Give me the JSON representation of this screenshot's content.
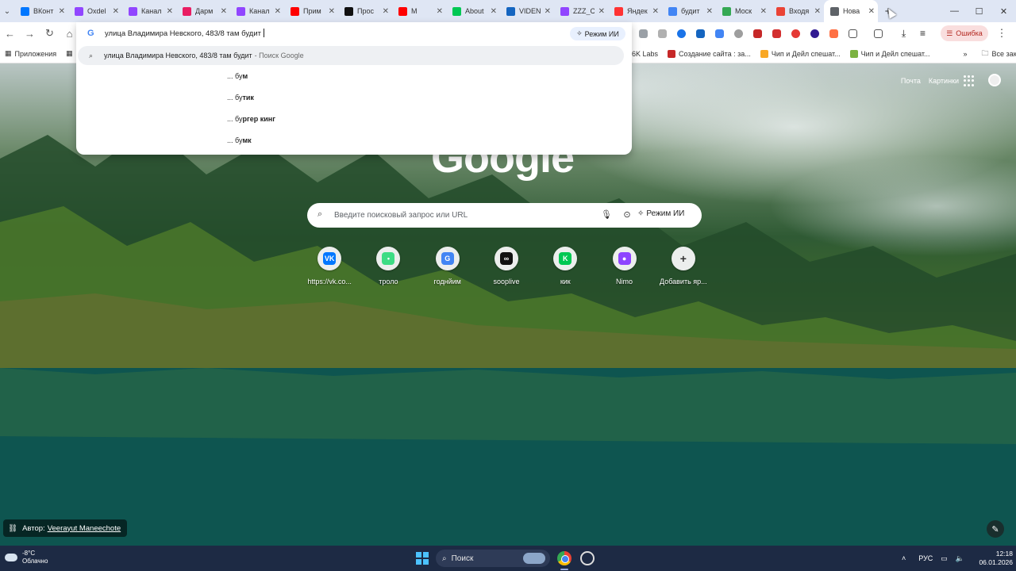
{
  "tabs": [
    {
      "title": "ВКонт",
      "color": "#0077ff",
      "glyph": "vk-icon"
    },
    {
      "title": "Oxdel",
      "color": "#9146ff",
      "glyph": "twitch-icon"
    },
    {
      "title": "Канал",
      "color": "#9146ff",
      "glyph": "twitch-icon"
    },
    {
      "title": "Дарм",
      "color": "#e91e63",
      "glyph": "app-icon"
    },
    {
      "title": "Канал",
      "color": "#9146ff",
      "glyph": "twitch-icon"
    },
    {
      "title": "Прим",
      "color": "#ff0000",
      "glyph": "youtube-icon"
    },
    {
      "title": "Прос",
      "color": "#111111",
      "glyph": "soop-icon"
    },
    {
      "title": "M",
      "color": "#ff0000",
      "glyph": "youtube-icon"
    },
    {
      "title": "About",
      "color": "#00c853",
      "glyph": "kick-icon"
    },
    {
      "title": "VIDEN",
      "color": "#1565c0",
      "glyph": "globe-icon"
    },
    {
      "title": "ZZZ_C",
      "color": "#9146ff",
      "glyph": "twitch-icon"
    },
    {
      "title": "Яндек",
      "color": "#ff3333",
      "glyph": "map-pin-icon"
    },
    {
      "title": "будит",
      "color": "#4285f4",
      "glyph": "google-icon"
    },
    {
      "title": "Моск",
      "color": "#34a853",
      "glyph": "maps-icon"
    },
    {
      "title": "Входя",
      "color": "#ea4335",
      "glyph": "gmail-icon"
    },
    {
      "title": "Нова",
      "color": "#5f6368",
      "glyph": "chrome-icon",
      "active": true
    }
  ],
  "omnibox": {
    "value": "улица Владимира Невского, 483/8 там будит",
    "ai_mode": "Режим ИИ",
    "first_suggestion": "улица Владимира Невского, 483/8 там будит",
    "first_suggestion_suffix": "- Поиск Google",
    "suggestions": [
      {
        "prefix": "... бу",
        "bold": "м"
      },
      {
        "prefix": "... бу",
        "bold": "тик"
      },
      {
        "prefix": "... бу",
        "bold": "ргер кинг"
      },
      {
        "prefix": "... бу",
        "bold": "мк"
      }
    ]
  },
  "toolbar": {
    "error_label": "Ошибка"
  },
  "bookmarks": {
    "apps": "Приложения",
    "items": [
      "6K Labs",
      "Создание сайта : за...",
      "Чип и Дейл спешат...",
      "Чип и Дейл спешат..."
    ],
    "all": "Все закладки"
  },
  "ntp": {
    "links": [
      "Почта",
      "Картинки"
    ],
    "logo": "Google",
    "search_placeholder": "Введите поисковый запрос или URL",
    "ai_mode": "Режим ИИ",
    "tiles": [
      {
        "label": "https://vk.co...",
        "color": "#0077ff",
        "glyph": "vk-icon",
        "mark": "VK"
      },
      {
        "label": "троло",
        "color": "#3ddc84",
        "glyph": "app-icon",
        "mark": "•"
      },
      {
        "label": "годнйим",
        "color": "#4285f4",
        "glyph": "google-icon",
        "mark": "G"
      },
      {
        "label": "sooplive",
        "color": "#111111",
        "glyph": "soop-icon",
        "mark": "∞"
      },
      {
        "label": "кик",
        "color": "#00c853",
        "glyph": "kick-icon",
        "mark": "K"
      },
      {
        "label": "Nimo",
        "color": "#8e44ff",
        "glyph": "nimo-icon",
        "mark": "●"
      },
      {
        "label": "Добавить яр...",
        "color": "#eceeed",
        "glyph": "plus-icon",
        "mark": "+"
      }
    ],
    "attribution_prefix": "Автор:",
    "attribution_name": "Veerayut Maneechote"
  },
  "taskbar": {
    "temp": "-8°C",
    "weather": "Облачно",
    "search": "Поиск",
    "lang": "РУС",
    "time": "12:18",
    "date": "06.01.2026"
  }
}
